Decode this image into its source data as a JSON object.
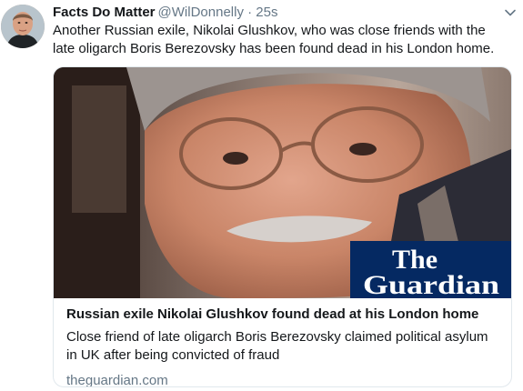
{
  "tweet": {
    "display_name": "Facts Do Matter",
    "handle": "@WilDonnelly",
    "separator": "·",
    "time": "25s",
    "text": "Another Russian exile, Nikolai Glushkov, who was close friends with the late oligarch Boris Berezovsky has been found dead in his London home."
  },
  "card": {
    "logo_line1": "The",
    "logo_line2": "Guardian",
    "title": "Russian exile Nikolai Glushkov found dead at his London home",
    "description": "Close friend of late oligarch Boris Berezovsky claimed political asylum in UK after being convicted of fraud",
    "domain": "theguardian.com"
  },
  "colors": {
    "guardian_blue": "#052962",
    "secondary_text": "#657786",
    "border": "#e1e8ed"
  },
  "icons": {
    "caret": "chevron-down-icon"
  }
}
